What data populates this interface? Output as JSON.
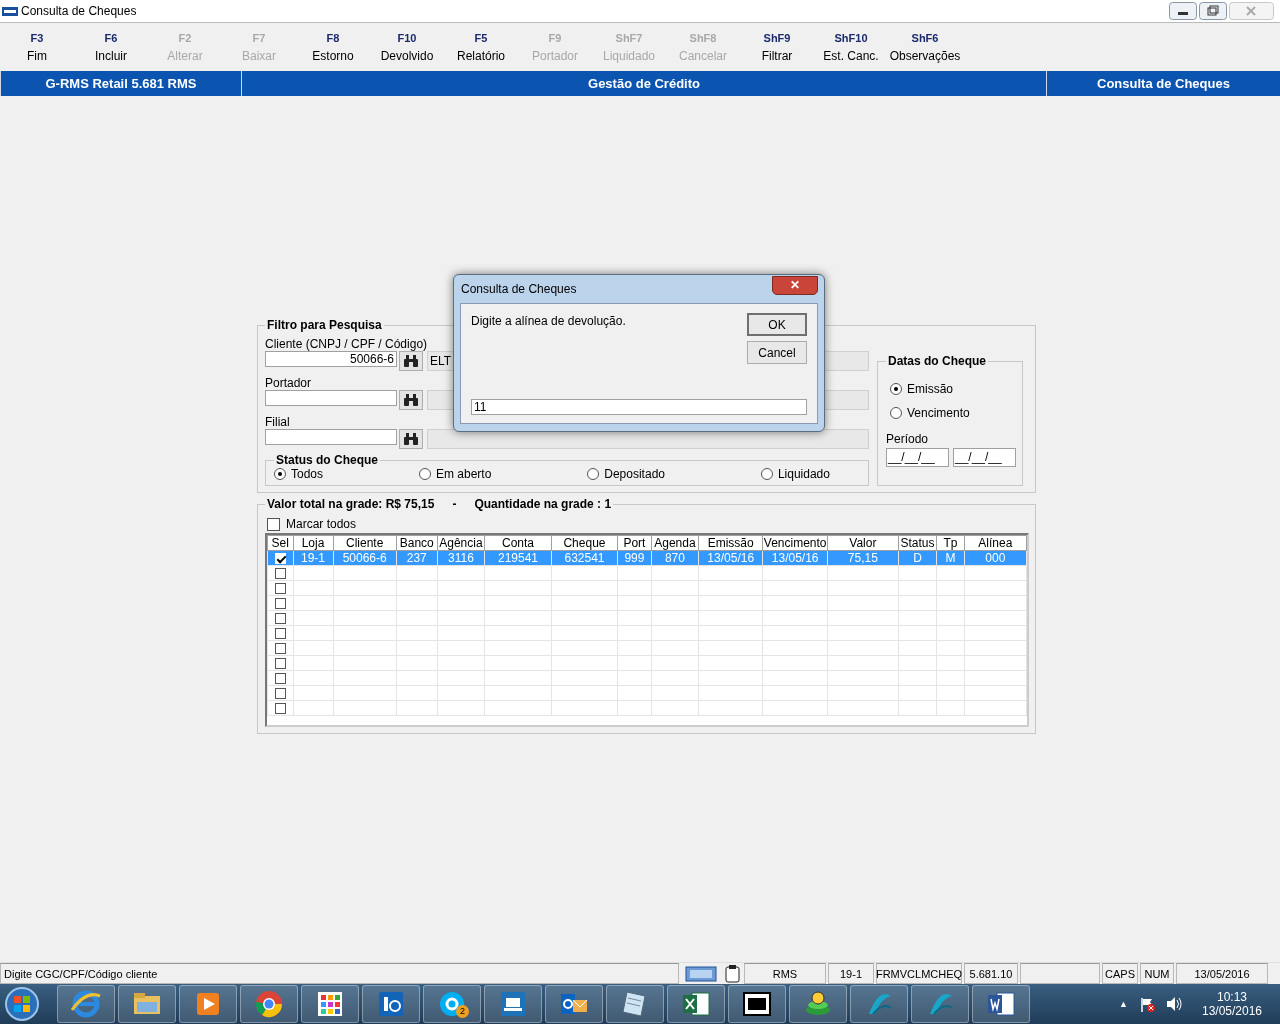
{
  "window": {
    "title": "Consulta de Cheques"
  },
  "toolbar": [
    {
      "key": "F3",
      "label": "Fim",
      "disabled": false
    },
    {
      "key": "F6",
      "label": "Incluir",
      "disabled": false
    },
    {
      "key": "F2",
      "label": "Alterar",
      "disabled": true
    },
    {
      "key": "F7",
      "label": "Baixar",
      "disabled": true
    },
    {
      "key": "F8",
      "label": "Estorno",
      "disabled": false
    },
    {
      "key": "F10",
      "label": "Devolvido",
      "disabled": false
    },
    {
      "key": "F5",
      "label": "Relatório",
      "disabled": false
    },
    {
      "key": "F9",
      "label": "Portador",
      "disabled": true
    },
    {
      "key": "ShF7",
      "label": "Liquidado",
      "disabled": true
    },
    {
      "key": "ShF8",
      "label": "Cancelar",
      "disabled": true
    },
    {
      "key": "ShF9",
      "label": "Filtrar",
      "disabled": false
    },
    {
      "key": "ShF10",
      "label": "Est. Canc.",
      "disabled": false
    },
    {
      "key": "ShF6",
      "label": "Observações",
      "disabled": false
    }
  ],
  "header": {
    "product": "G-RMS Retail 5.681 RMS",
    "module": "Gestão de Crédito",
    "screen": "Consulta de Cheques"
  },
  "filter": {
    "title": "Filtro para Pesquisa",
    "fields": [
      {
        "label": "Cliente (CNPJ / CPF / Código)",
        "value": "50066-6",
        "description": "ELT"
      },
      {
        "label": "Portador"
      },
      {
        "label": "Filial"
      }
    ],
    "status": {
      "title": "Status do Cheque",
      "options": [
        {
          "label": "Todos",
          "selected": true
        },
        {
          "label": "Em aberto",
          "selected": false
        },
        {
          "label": "Depositado",
          "selected": false
        },
        {
          "label": "Liquidado",
          "selected": false
        }
      ]
    },
    "dates": {
      "title": "Datas do Cheque",
      "options": [
        {
          "label": "Emissão",
          "selected": true
        },
        {
          "label": "Vencimento",
          "selected": false
        }
      ],
      "period_label": "Período",
      "period_from": "__/__/__",
      "period_to": "__/__/__"
    }
  },
  "grid": {
    "total": "Valor total na grade: R$ 75,15",
    "separator": "-",
    "count": "Quantidade na grade : 1",
    "select_all": {
      "label": "Marcar todos",
      "checked": false
    },
    "columns": [
      "Sel",
      "Loja",
      "Cliente",
      "Banco",
      "Agência",
      "Conta",
      "Cheque",
      "Port",
      "Agenda",
      "Emissão",
      "Vencimento",
      "Valor",
      "Status",
      "Tp",
      "Alínea"
    ],
    "rows": [
      {
        "checked": true,
        "selected": true,
        "cells": [
          "",
          "19-1",
          "50066-6",
          "237",
          "3116",
          "219541",
          "632541",
          "999",
          "870",
          "13/05/16",
          "13/05/16",
          "75,15",
          "D",
          "M",
          "000"
        ]
      },
      {
        "checked": false,
        "selected": false,
        "cells": []
      },
      {
        "checked": false,
        "selected": false,
        "cells": []
      },
      {
        "checked": false,
        "selected": false,
        "cells": []
      },
      {
        "checked": false,
        "selected": false,
        "cells": []
      },
      {
        "checked": false,
        "selected": false,
        "cells": []
      },
      {
        "checked": false,
        "selected": false,
        "cells": []
      },
      {
        "checked": false,
        "selected": false,
        "cells": []
      },
      {
        "checked": false,
        "selected": false,
        "cells": []
      },
      {
        "checked": false,
        "selected": false,
        "cells": []
      },
      {
        "checked": false,
        "selected": false,
        "cells": []
      }
    ]
  },
  "dialog": {
    "title": "Consulta de Cheques",
    "close": "✕",
    "message": "Digite a alínea de devolução.",
    "buttons": [
      "OK",
      "Cancel"
    ],
    "value": "11"
  },
  "status_bar": {
    "hint": "Digite CGC/CPF/Código cliente",
    "cells": [
      "RMS",
      "19-1",
      "FRMVCLMCHEQ",
      "5.681.10"
    ],
    "indicators": [
      "CAPS",
      "NUM",
      "13/05/2016"
    ]
  },
  "taskbar": {
    "apps": [
      {
        "kind": "browser"
      },
      {
        "kind": "folder"
      },
      {
        "kind": "media"
      },
      {
        "kind": "chrome"
      },
      {
        "kind": "grid"
      },
      {
        "kind": "sync"
      },
      {
        "kind": "chat",
        "badge": "2"
      },
      {
        "kind": "laptop"
      },
      {
        "kind": "mail"
      },
      {
        "kind": "notes"
      },
      {
        "kind": "sheet"
      },
      {
        "kind": "archive"
      },
      {
        "kind": "network"
      },
      {
        "kind": "swirl"
      },
      {
        "kind": "swirl"
      },
      {
        "kind": "doc"
      }
    ],
    "tray_arrow": "▲",
    "time": "10:13",
    "date": "13/05/2016"
  }
}
